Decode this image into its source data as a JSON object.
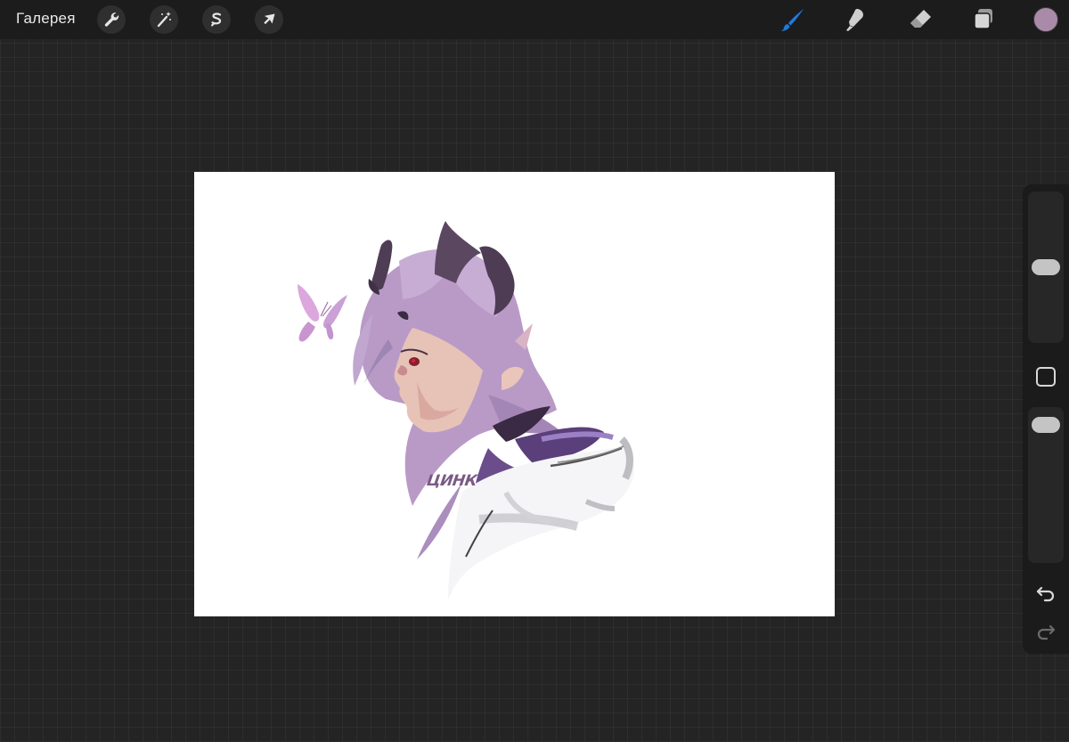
{
  "toolbar": {
    "gallery_label": "Галерея",
    "left_tools": [
      {
        "name": "actions",
        "icon": "wrench-icon"
      },
      {
        "name": "adjustments",
        "icon": "magic-wand-icon"
      },
      {
        "name": "selection",
        "icon": "selection-s-icon"
      },
      {
        "name": "transform",
        "icon": "arrow-cursor-icon"
      }
    ],
    "right_tools": [
      {
        "name": "brush",
        "icon": "brush-icon",
        "active": true
      },
      {
        "name": "smudge",
        "icon": "smudge-icon",
        "active": false
      },
      {
        "name": "eraser",
        "icon": "eraser-icon",
        "active": false
      },
      {
        "name": "layers",
        "icon": "layers-icon",
        "active": false
      }
    ],
    "current_color": "#a98aa8"
  },
  "canvas": {
    "signature": "ЦИНК",
    "signature_color": "#7a5a85"
  },
  "sidebar": {
    "brush_size_fraction": 0.5,
    "opacity_fraction": 0.95,
    "undo_icon": "undo-icon",
    "redo_icon": "redo-icon"
  },
  "colors": {
    "accent_blue": "#1f7ae0",
    "background": "#242424",
    "toolbar": "#1c1c1c"
  }
}
